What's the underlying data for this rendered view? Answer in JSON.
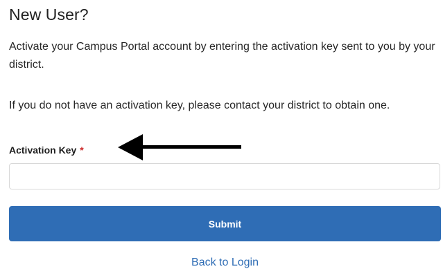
{
  "heading": "New User?",
  "intro_text": "Activate your Campus Portal account by entering the activation key sent to you by your district.",
  "help_text": "If you do not have an activation key, please contact your district to obtain one.",
  "activation_field": {
    "label": "Activation Key",
    "required_marker": "*",
    "value": "",
    "placeholder": ""
  },
  "submit_label": "Submit",
  "back_link_label": "Back to Login",
  "annotation": {
    "icon": "left-arrow-icon",
    "color": "#000000"
  },
  "colors": {
    "primary": "#2f6db5",
    "required": "#cc2a2a"
  }
}
